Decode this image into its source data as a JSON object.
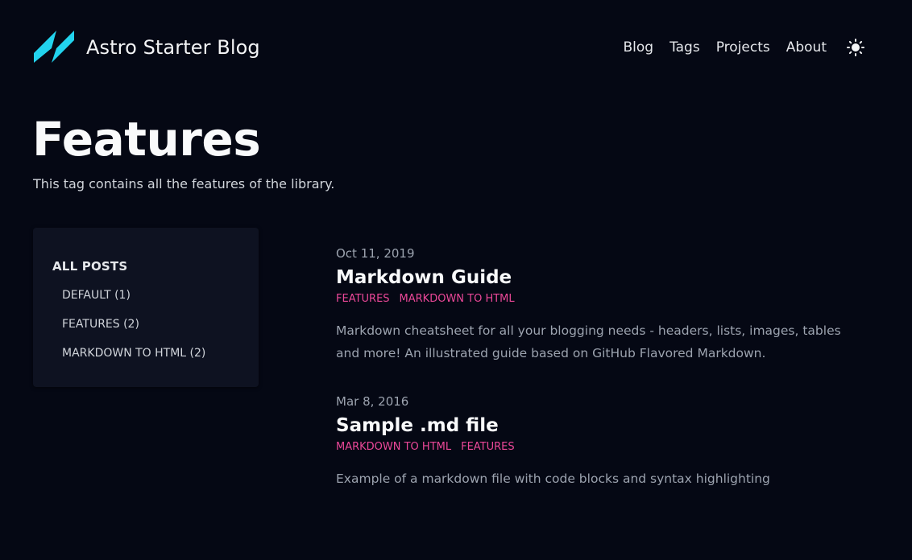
{
  "site": {
    "title": "Astro Starter Blog",
    "logo_icon": "astro-logo-icon",
    "logo_color": "#22d3ee"
  },
  "nav": {
    "items": [
      "Blog",
      "Tags",
      "Projects",
      "About"
    ],
    "theme_toggle_icon": "sun-icon"
  },
  "page": {
    "title": "Features",
    "description": "This tag contains all the features of the library."
  },
  "sidebar": {
    "heading": "ALL POSTS",
    "tags": [
      "DEFAULT (1)",
      "FEATURES (2)",
      "MARKDOWN TO HTML (2)"
    ]
  },
  "posts": [
    {
      "date": "Oct 11, 2019",
      "title": "Markdown Guide",
      "tags": [
        "FEATURES",
        "MARKDOWN TO HTML"
      ],
      "description": "Markdown cheatsheet for all your blogging needs - headers, lists, images, tables and more! An illustrated guide based on GitHub Flavored Markdown."
    },
    {
      "date": "Mar 8, 2016",
      "title": "Sample .md file",
      "tags": [
        "MARKDOWN TO HTML",
        "FEATURES"
      ],
      "description": "Example of a markdown file with code blocks and syntax highlighting"
    }
  ],
  "colors": {
    "background": "#050814",
    "sidebar_bg": "#0e1221",
    "tag_accent": "#ec4899",
    "logo_accent": "#22d3ee"
  }
}
